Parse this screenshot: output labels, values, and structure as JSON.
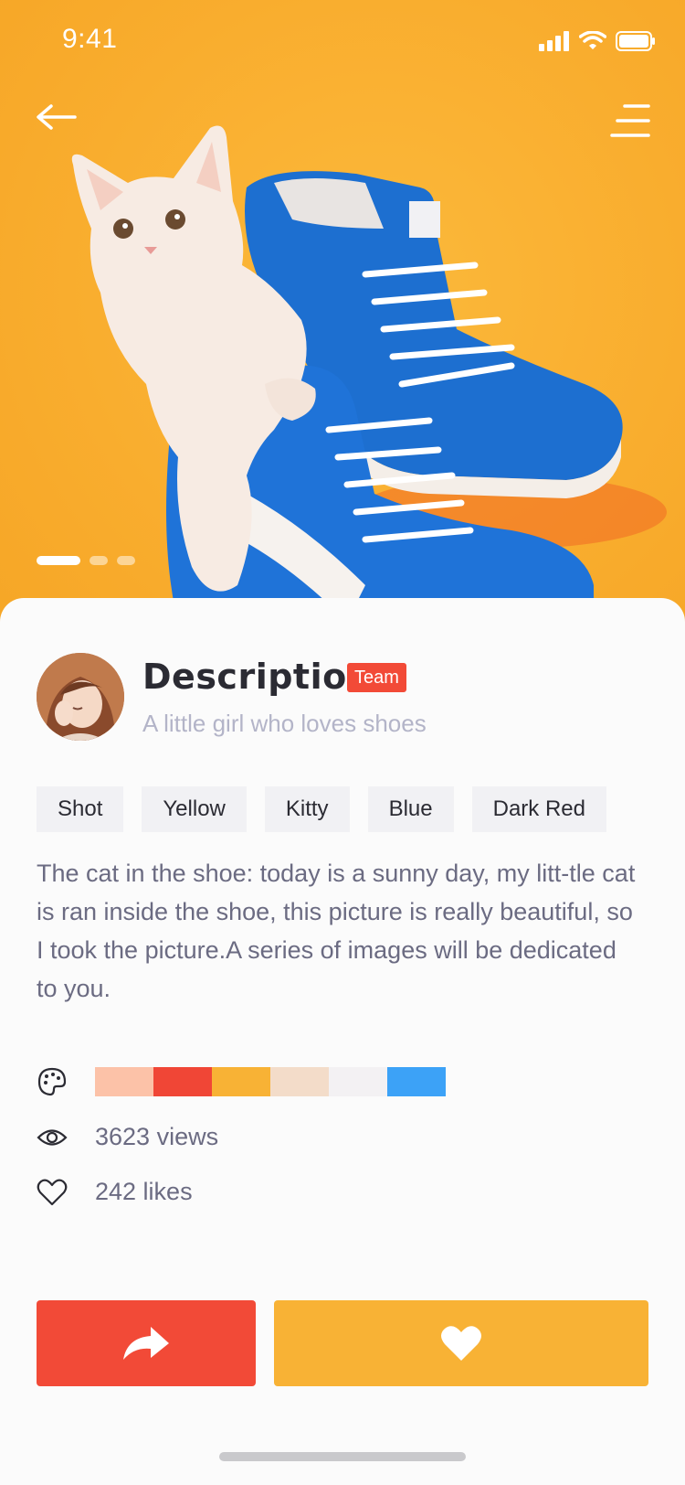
{
  "status_bar": {
    "time": "9:41"
  },
  "hero": {
    "carousel_count": 3,
    "active_slide": 1
  },
  "profile": {
    "title": "Description",
    "badge": "Team",
    "subtitle": "A little girl who loves shoes"
  },
  "tags": [
    "Shot",
    "Yellow",
    "Kitty",
    "Blue",
    "Dark Red"
  ],
  "description": "The cat in the shoe: today is a sunny day, my litt-tle cat  is ran inside the shoe, this picture is really beautiful, so I took the picture.A series of images will be dedicated to you.",
  "palette": {
    "icon": "palette-icon",
    "colors": [
      "#fcc2a8",
      "#f04636",
      "#f8b235",
      "#f3dcc9",
      "#f3f1f3",
      "#3ca2f7"
    ]
  },
  "stats": {
    "views": "3623 views",
    "likes": "242 likes",
    "views_icon": "eye-icon",
    "likes_icon": "heart-outline-icon"
  },
  "actions": {
    "share_icon": "share-arrow-icon",
    "like_icon": "heart-filled-icon",
    "share_color": "#f24a37",
    "like_color": "#f8b235"
  }
}
